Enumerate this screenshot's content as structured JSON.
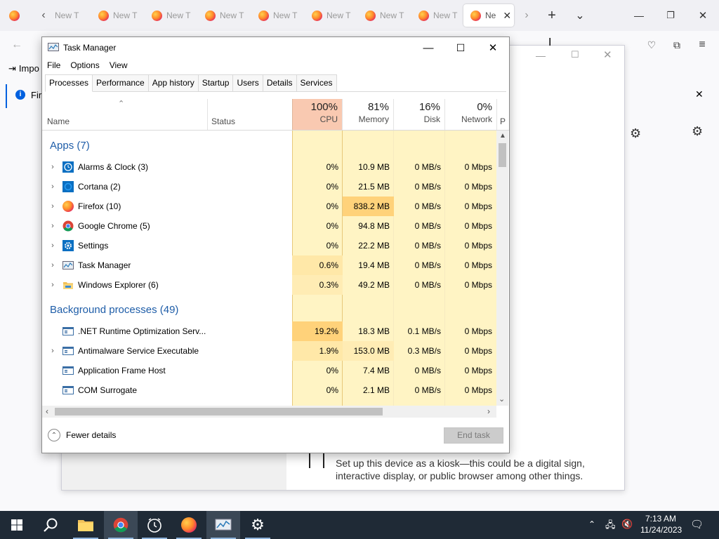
{
  "browser": {
    "tab_label": "New T",
    "tab_active_label": "Ne",
    "bookmarks": {
      "import_label": "Impo"
    },
    "infobar": {
      "text": "Fir"
    },
    "background_dialog": {
      "kiosk_desc_line1": "Set up this device as a kiosk—this could be a digital sign,",
      "kiosk_desc_line2": "interactive display, or public browser among other things."
    }
  },
  "task_manager": {
    "title": "Task Manager",
    "menu": [
      "File",
      "Options",
      "View"
    ],
    "tabs": [
      "Processes",
      "Performance",
      "App history",
      "Startup",
      "Users",
      "Details",
      "Services"
    ],
    "columns": {
      "name": "Name",
      "status": "Status",
      "cpu": {
        "pct": "100%",
        "label": "CPU"
      },
      "memory": {
        "pct": "81%",
        "label": "Memory"
      },
      "disk": {
        "pct": "16%",
        "label": "Disk"
      },
      "network": {
        "pct": "0%",
        "label": "Network"
      },
      "power": "P"
    },
    "groups": {
      "apps": "Apps (7)",
      "background": "Background processes (49)"
    },
    "apps": [
      {
        "name": "Alarms & Clock (3)",
        "cpu": "0%",
        "memory": "10.9 MB",
        "disk": "0 MB/s",
        "network": "0 Mbps",
        "icon": "alarms-clock-icon"
      },
      {
        "name": "Cortana (2)",
        "cpu": "0%",
        "memory": "21.5 MB",
        "disk": "0 MB/s",
        "network": "0 Mbps",
        "icon": "cortana-icon"
      },
      {
        "name": "Firefox (10)",
        "cpu": "0%",
        "memory": "838.2 MB",
        "disk": "0 MB/s",
        "network": "0 Mbps",
        "icon": "firefox-icon"
      },
      {
        "name": "Google Chrome (5)",
        "cpu": "0%",
        "memory": "94.8 MB",
        "disk": "0 MB/s",
        "network": "0 Mbps",
        "icon": "chrome-icon"
      },
      {
        "name": "Settings",
        "cpu": "0%",
        "memory": "22.2 MB",
        "disk": "0 MB/s",
        "network": "0 Mbps",
        "icon": "settings-icon"
      },
      {
        "name": "Task Manager",
        "cpu": "0.6%",
        "memory": "19.4 MB",
        "disk": "0 MB/s",
        "network": "0 Mbps",
        "icon": "task-manager-icon"
      },
      {
        "name": "Windows Explorer (6)",
        "cpu": "0.3%",
        "memory": "49.2 MB",
        "disk": "0 MB/s",
        "network": "0 Mbps",
        "icon": "explorer-icon"
      }
    ],
    "background": [
      {
        "name": ".NET Runtime Optimization Serv...",
        "cpu": "19.2%",
        "memory": "18.3 MB",
        "disk": "0.1 MB/s",
        "network": "0 Mbps"
      },
      {
        "name": "Antimalware Service Executable",
        "cpu": "1.9%",
        "memory": "153.0 MB",
        "disk": "0.3 MB/s",
        "network": "0 Mbps"
      },
      {
        "name": "Application Frame Host",
        "cpu": "0%",
        "memory": "7.4 MB",
        "disk": "0 MB/s",
        "network": "0 Mbps"
      },
      {
        "name": "COM Surrogate",
        "cpu": "0%",
        "memory": "2.1 MB",
        "disk": "0 MB/s",
        "network": "0 Mbps"
      }
    ],
    "footer": {
      "fewer_details": "Fewer details",
      "end_task": "End task"
    }
  },
  "taskbar": {
    "time": "7:13 AM",
    "date": "11/24/2023"
  },
  "colors": {
    "cpu_header": "#f9c9b1",
    "heat_low": "#fff4c4",
    "heat_mid": "#ffe8a8",
    "heat_high": "#ffd27a",
    "group_text": "#1e5da8"
  }
}
